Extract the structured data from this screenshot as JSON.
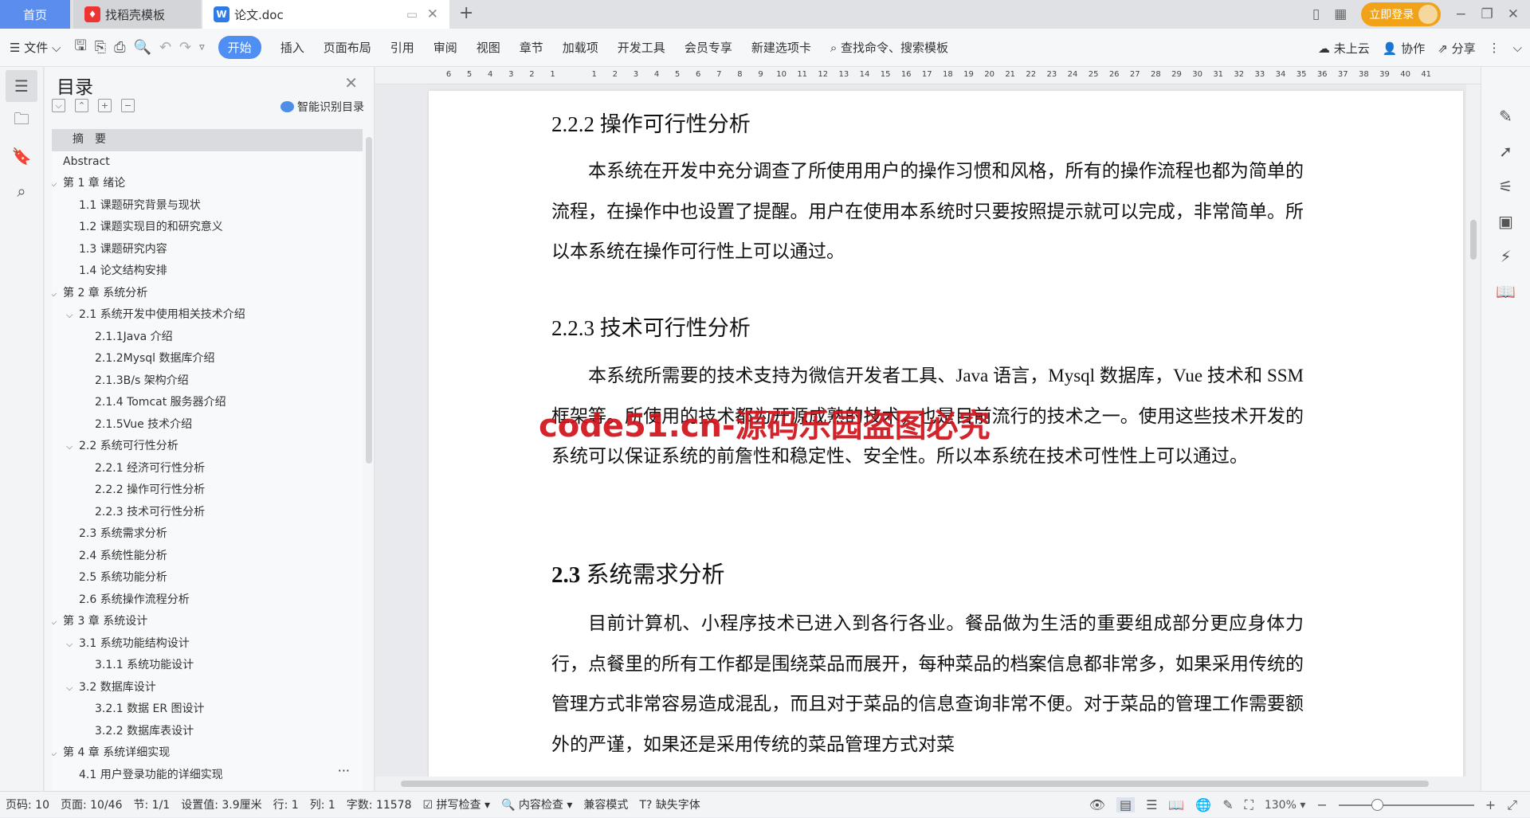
{
  "tabs": {
    "home": "首页",
    "template": "找稻壳模板",
    "doc": "论文.doc",
    "new_tab": "+"
  },
  "titlebar": {
    "login": "立即登录"
  },
  "toolbar": {
    "file": "文件",
    "menus": [
      "开始",
      "插入",
      "页面布局",
      "引用",
      "审阅",
      "视图",
      "章节",
      "加载项",
      "开发工具",
      "会员专享",
      "新建选项卡"
    ],
    "search_placeholder": "查找命令、搜索模板",
    "cloud": "未上云",
    "collab": "协作",
    "share": "分享"
  },
  "ruler": [
    "6",
    "5",
    "4",
    "3",
    "2",
    "1",
    "",
    "1",
    "2",
    "3",
    "4",
    "5",
    "6",
    "7",
    "8",
    "9",
    "10",
    "11",
    "12",
    "13",
    "14",
    "15",
    "16",
    "17",
    "18",
    "19",
    "20",
    "21",
    "22",
    "23",
    "24",
    "25",
    "26",
    "27",
    "28",
    "29",
    "30",
    "31",
    "32",
    "33",
    "34",
    "35",
    "36",
    "37",
    "38",
    "39",
    "40",
    "41"
  ],
  "toc": {
    "title": "目录",
    "smart": "智能识别目录",
    "items": [
      {
        "label": "摘　要",
        "level": 0,
        "selected": true
      },
      {
        "label": "Abstract",
        "level": 0
      },
      {
        "label": "第 1 章  绪论",
        "level": 0,
        "chev": true
      },
      {
        "label": "1.1 课题研究背景与现状",
        "level": 1
      },
      {
        "label": "1.2 课题实现目的和研究意义",
        "level": 1
      },
      {
        "label": "1.3 课题研究内容",
        "level": 1
      },
      {
        "label": "1.4 论文结构安排",
        "level": 1
      },
      {
        "label": "第 2 章  系统分析",
        "level": 0,
        "chev": true
      },
      {
        "label": "2.1 系统开发中使用相关技术介绍",
        "level": 1,
        "chev": true
      },
      {
        "label": "2.1.1Java 介绍",
        "level": 2
      },
      {
        "label": "2.1.2Mysql 数据库介绍",
        "level": 2
      },
      {
        "label": "2.1.3B/s 架构介绍",
        "level": 2
      },
      {
        "label": "2.1.4 Tomcat 服务器介绍",
        "level": 2
      },
      {
        "label": "2.1.5Vue 技术介绍",
        "level": 2
      },
      {
        "label": "2.2 系统可行性分析",
        "level": 1,
        "chev": true
      },
      {
        "label": "2.2.1 经济可行性分析",
        "level": 2
      },
      {
        "label": "2.2.2 操作可行性分析",
        "level": 2
      },
      {
        "label": "2.2.3 技术可行性分析",
        "level": 2
      },
      {
        "label": "2.3 系统需求分析",
        "level": 1
      },
      {
        "label": "2.4 系统性能分析",
        "level": 1
      },
      {
        "label": "2.5 系统功能分析",
        "level": 1
      },
      {
        "label": "2.6 系统操作流程分析",
        "level": 1
      },
      {
        "label": "第 3 章  系统设计",
        "level": 0,
        "chev": true
      },
      {
        "label": "3.1 系统功能结构设计",
        "level": 1,
        "chev": true
      },
      {
        "label": "3.1.1 系统功能设计",
        "level": 2
      },
      {
        "label": "3.2 数据库设计",
        "level": 1,
        "chev": true
      },
      {
        "label": "3.2.1 数据 ER 图设计",
        "level": 2
      },
      {
        "label": "3.2.2 数据库表设计",
        "level": 2
      },
      {
        "label": "第 4 章  系统详细实现",
        "level": 0,
        "chev": true
      },
      {
        "label": "4.1 用户登录功能的详细实现",
        "level": 1
      }
    ]
  },
  "document": {
    "h1": "2.2.2 操作可行性分析",
    "p1": "本系统在开发中充分调查了所使用用户的操作习惯和风格，所有的操作流程也都为简单的流程，在操作中也设置了提醒。用户在使用本系统时只要按照提示就可以完成，非常简单。所以本系统在操作可行性上可以通过。",
    "h2": "2.2.3 技术可行性分析",
    "p2": "本系统所需要的技术支持为微信开发者工具、Java 语言，Mysql 数据库，Vue 技术和 SSM 框架等。所使用的技术都为开源成熟的技术，也是目前流行的技术之一。使用这些技术开发的系统可以保证系统的前詹性和稳定性、安全性。所以本系统在技术可性性上可以通过。",
    "h3_num": "2.3",
    "h3_text": " 系统需求分析",
    "p3": "目前计算机、小程序技术已进入到各行各业。餐品做为生活的重要组成部分更应身体力行，点餐里的所有工作都是围绕菜品而展开，每种菜品的档案信息都非常多，如果采用传统的管理方式非常容易造成混乱，而且对于菜品的信息查询非常不便。对于菜品的管理工作需要额外的严谨，如果还是采用传统的菜品管理方式对菜",
    "watermark": "code51.cn-源码乐园盗图必究"
  },
  "status": {
    "page_no": "页码: 10",
    "pages": "页面: 10/46",
    "section": "节: 1/1",
    "setting": "设置值: 3.9厘米",
    "row": "行: 1",
    "col": "列: 1",
    "words": "字数: 11578",
    "spell": "拼写检查",
    "content_check": "内容检查",
    "compat": "兼容模式",
    "missing_font": "缺失字体",
    "zoom": "130%",
    "zoom_level": 130
  }
}
